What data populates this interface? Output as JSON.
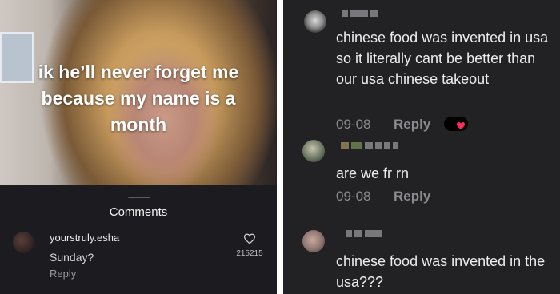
{
  "left_panel": {
    "caption_line1": "ik he’ll never forget me",
    "caption_line2": "because my name is a",
    "caption_line3": "month",
    "comments_title": "Comments",
    "comment": {
      "username": "yourstruly.esha",
      "text": "Sunday?",
      "reply_label": "Reply",
      "like_count": "215215"
    }
  },
  "right_panel": {
    "comments": [
      {
        "text": "chinese food was invented in usa so it literally cant be better than our usa chinese takeout",
        "date": "09-08",
        "reply_label": "Reply",
        "liked_by_creator": true
      },
      {
        "text": "are we fr rn",
        "date": "09-08",
        "reply_label": "Reply"
      },
      {
        "text": "chinese food was invented in the usa???"
      }
    ]
  },
  "colors": {
    "left_sheet_bg": "#1c1b20",
    "right_bg": "#222123",
    "text_primary": "#ececee",
    "text_secondary": "#8a8a90",
    "heart_red": "#fe2c55"
  },
  "icons": {
    "heart": "heart-outline-icon",
    "liked_heart": "heart-filled-icon"
  }
}
